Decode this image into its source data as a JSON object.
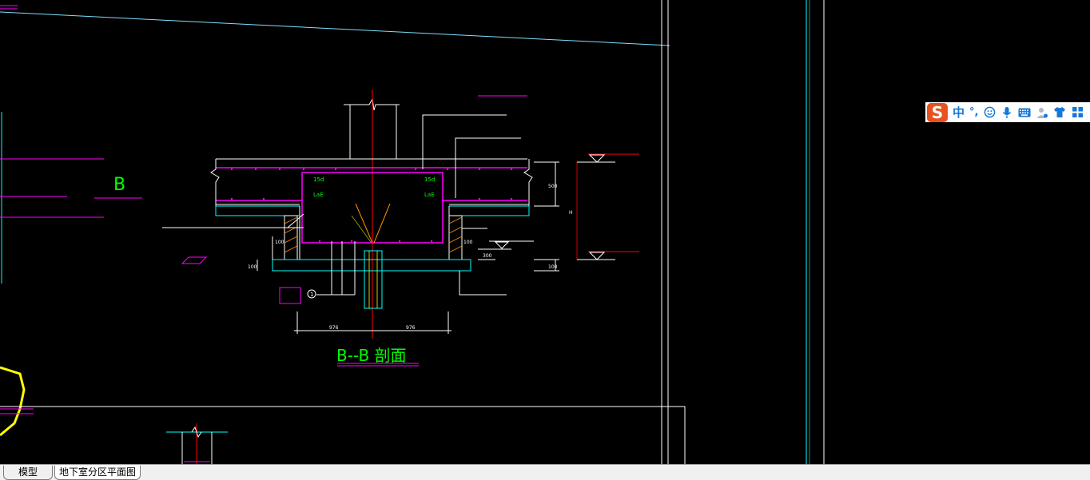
{
  "drawing": {
    "section_label": "B",
    "section_title": "B--B 剖面",
    "labels": {
      "dim_left_1": "976",
      "dim_right_1": "976",
      "left_top": "15d",
      "right_top": "15d",
      "left_lae": "LaE",
      "right_lae": "LaE",
      "dim_500": "500",
      "dim_h": "H",
      "dim_100a": "100",
      "dim_100b": "100",
      "dim_100c": "100",
      "dim_100d": "100",
      "dim_300": "300",
      "circle_num": "1"
    }
  },
  "ime": {
    "logo": "S",
    "mode": "中",
    "punct": "°,",
    "icons": [
      "smile-icon",
      "microphone-icon",
      "keyboard-icon",
      "user-icon",
      "shirt-icon",
      "grid-icon"
    ]
  },
  "tabs": {
    "model": "模型",
    "layout": "地下室分区平面图"
  },
  "colors": {
    "background": "#000000",
    "cyan": "#00ffff",
    "magenta": "#ff00ff",
    "white": "#ffffff",
    "green": "#00ff00",
    "red": "#ff0000",
    "yellow": "#ffff00",
    "orange": "#ff8c00"
  }
}
